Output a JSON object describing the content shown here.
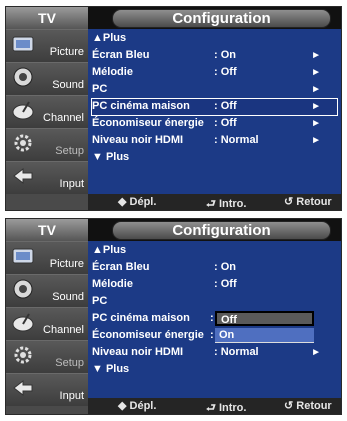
{
  "panels": [
    {
      "sidebar": {
        "header": "TV",
        "items": [
          {
            "label": "Picture",
            "icon": "picture-icon"
          },
          {
            "label": "Sound",
            "icon": "sound-icon"
          },
          {
            "label": "Channel",
            "icon": "channel-icon"
          },
          {
            "label": "Setup",
            "icon": "setup-icon"
          },
          {
            "label": "Input",
            "icon": "input-icon"
          }
        ]
      },
      "title": "Configuration",
      "rows": [
        {
          "label": "▲Plus",
          "value": "",
          "arrow": ""
        },
        {
          "label": "Écran Bleu",
          "value": ": On",
          "arrow": "►"
        },
        {
          "label": "Mélodie",
          "value": ": Off",
          "arrow": "►"
        },
        {
          "label": "PC",
          "value": "",
          "arrow": "►"
        },
        {
          "label": "PC cinéma maison",
          "value": ": Off",
          "arrow": "►"
        },
        {
          "label": "Économiseur énergie",
          "value": ": Off",
          "arrow": "►"
        },
        {
          "label": "Niveau noir HDMI",
          "value": ": Normal",
          "arrow": "►"
        },
        {
          "label": "▼ Plus",
          "value": "",
          "arrow": ""
        }
      ],
      "footer": {
        "move": "◆ Dépl.",
        "enter": "⮐ Intro.",
        "back": "↺ Retour"
      }
    },
    {
      "sidebar": {
        "header": "TV",
        "items": [
          {
            "label": "Picture",
            "icon": "picture-icon"
          },
          {
            "label": "Sound",
            "icon": "sound-icon"
          },
          {
            "label": "Channel",
            "icon": "channel-icon"
          },
          {
            "label": "Setup",
            "icon": "setup-icon"
          },
          {
            "label": "Input",
            "icon": "input-icon"
          }
        ]
      },
      "title": "Configuration",
      "rows": [
        {
          "label": "▲Plus",
          "value": "",
          "arrow": ""
        },
        {
          "label": "Écran Bleu",
          "value": ": On",
          "arrow": ""
        },
        {
          "label": "Mélodie",
          "value": ": Off",
          "arrow": ""
        },
        {
          "label": "PC",
          "value": "",
          "arrow": ""
        },
        {
          "label": "PC cinéma maison",
          "value": ":",
          "arrow": ""
        },
        {
          "label": "Économiseur énergie",
          "value": ":",
          "arrow": ""
        },
        {
          "label": "Niveau noir HDMI",
          "value": ": Normal",
          "arrow": "►"
        },
        {
          "label": "▼ Plus",
          "value": "",
          "arrow": ""
        }
      ],
      "dropdown": {
        "options": [
          "Off",
          "On"
        ],
        "selected": "Off"
      },
      "footer": {
        "move": "◆ Dépl.",
        "enter": "⮐ Intro.",
        "back": "↺ Retour"
      }
    }
  ],
  "colors": {
    "main_bg": "#1c3a86",
    "sidebar_bg": "#4a4a4a",
    "highlight_border": "#ffffff",
    "dropdown_alt_bg": "#4f6fc0"
  }
}
